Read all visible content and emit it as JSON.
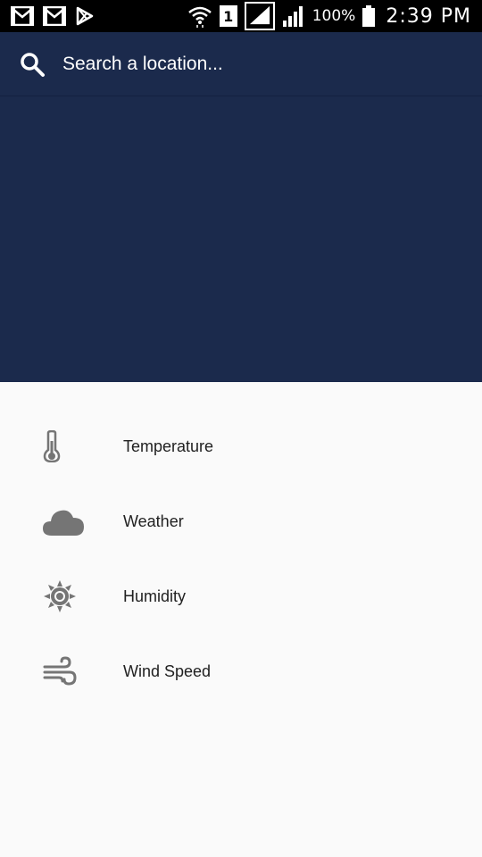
{
  "status_bar": {
    "battery_percent": "100%",
    "clock": "2:39 PM",
    "sim_slot": "1",
    "icons": [
      "gmail-icon",
      "gmail-icon",
      "play-store-icon",
      "wifi-icon",
      "sim-icon",
      "signal-icon",
      "signal-icon",
      "battery-icon"
    ]
  },
  "search": {
    "placeholder": "Search a location...",
    "value": ""
  },
  "colors": {
    "header_bg": "#1b2a4c",
    "list_bg": "#fafafa",
    "icon_gray": "#757575"
  },
  "list": {
    "items": [
      {
        "label": "Temperature",
        "icon": "thermometer-icon"
      },
      {
        "label": "Weather",
        "icon": "cloud-icon"
      },
      {
        "label": "Humidity",
        "icon": "sun-icon"
      },
      {
        "label": "Wind Speed",
        "icon": "wind-icon"
      }
    ]
  }
}
